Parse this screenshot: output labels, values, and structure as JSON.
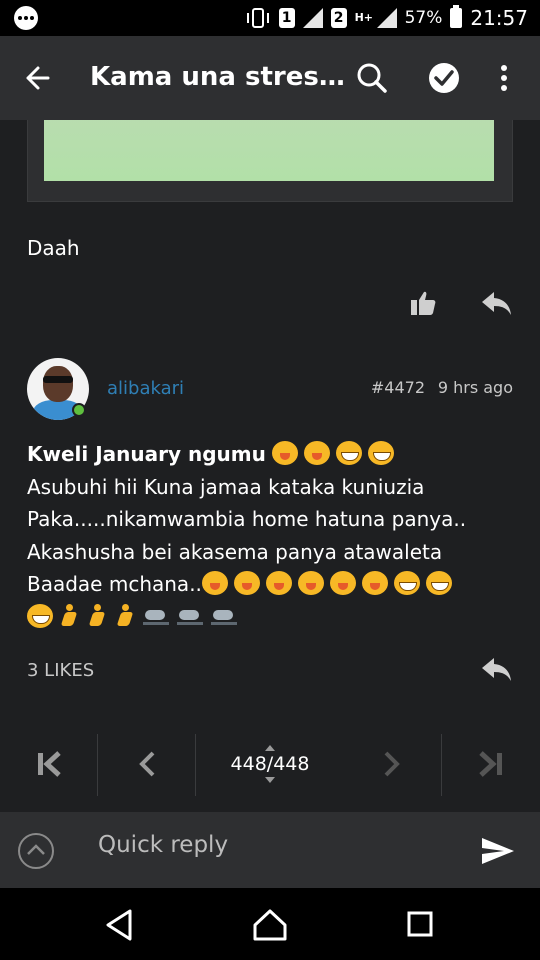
{
  "status_bar": {
    "sim1": "1",
    "sim2": "2",
    "network": "H+",
    "battery_percent": "57%",
    "time": "21:57"
  },
  "app_bar": {
    "title": "Kama una stres…",
    "icons": [
      "back-arrow-icon",
      "search-icon",
      "check-circle-icon",
      "more-vertical-icon"
    ]
  },
  "previous_post": {
    "text": "Daah"
  },
  "post": {
    "username": "alibakari",
    "post_number": "#4472",
    "time": "9 hrs ago",
    "line1_bold": "Kweli January ngumu",
    "line2": "Asubuhi hii Kuna jamaa kataka kuniuzia",
    "line3": "Paka.....nikamwambia home hatuna panya..",
    "line4": "Akashusha bei akasema panya atawaleta",
    "line5": "Baadae mchana..",
    "likes": "3 LIKES"
  },
  "pager": {
    "label": "448/448"
  },
  "quick_reply": {
    "placeholder": "Quick reply"
  },
  "colors": {
    "background": "#1e1f21",
    "toolbar": "#2e2f31",
    "username": "#2f7fb5",
    "online": "#5fbf3f"
  }
}
